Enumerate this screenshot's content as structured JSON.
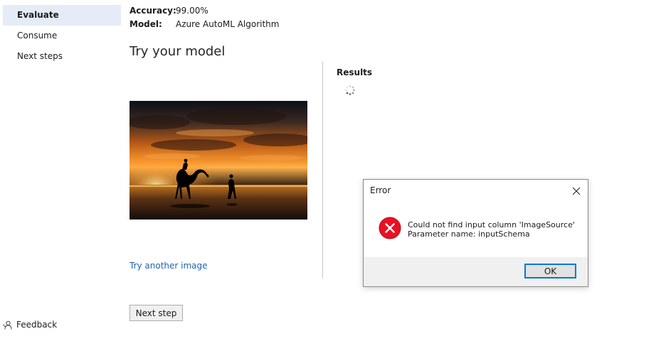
{
  "nav": {
    "items": [
      {
        "label": "Evaluate",
        "active": true
      },
      {
        "label": "Consume",
        "active": false
      },
      {
        "label": "Next steps",
        "active": false
      }
    ],
    "feedback_label": "Feedback",
    "feedback_icon": "feedback-icon"
  },
  "model_info": {
    "accuracy_label": "Accuracy:",
    "accuracy_value": "99.00%",
    "model_label": "Model:",
    "model_value": "Azure AutoML Algorithm"
  },
  "try_model": {
    "title": "Try your model",
    "image_subject": "camel-sunset-photo",
    "try_another_label": "Try another image",
    "link_color": "#1a63b4"
  },
  "results": {
    "title": "Results",
    "loading_icon": "spinner-icon"
  },
  "next_step_label": "Next step",
  "error_dialog": {
    "title": "Error",
    "close_icon": "close-icon",
    "error_icon": "error-icon",
    "message_line1": "Could not find input column 'ImageSource'",
    "message_line2": "Parameter name: inputSchema",
    "ok_label": "OK",
    "error_color": "#e81123"
  },
  "colors": {
    "nav_active_bg": "#e5ecf8",
    "accent": "#0078d7"
  }
}
